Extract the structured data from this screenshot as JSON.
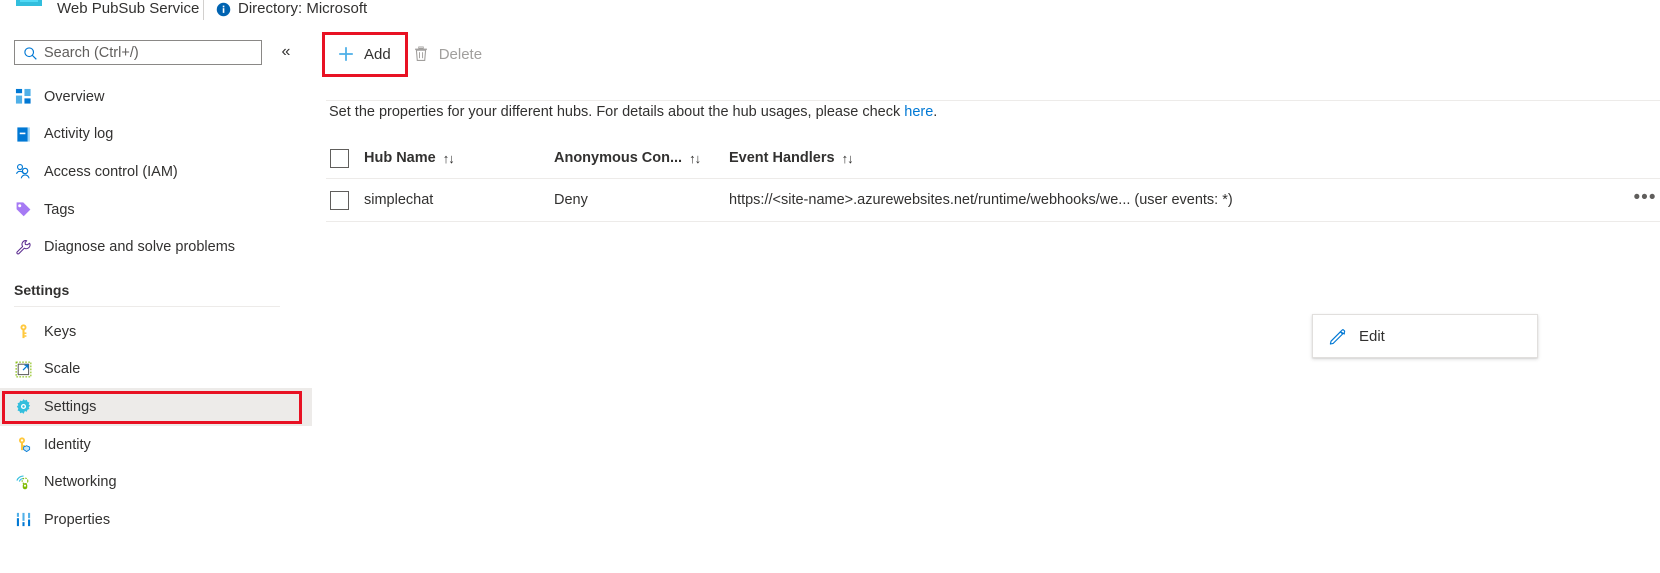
{
  "topbar": {
    "logo_icon": "web-pubsub-logo-icon",
    "service_title": "Web PubSub Service",
    "info_icon": "info-icon",
    "directory_text": "Directory: Microsoft"
  },
  "sidebar": {
    "search": {
      "placeholder": "Search (Ctrl+/)",
      "value": "",
      "icon": "search-icon"
    },
    "collapse_icon": "«",
    "items": [
      {
        "label": "Overview",
        "icon": "overview-icon",
        "selected": false
      },
      {
        "label": "Activity log",
        "icon": "activity-log-icon",
        "selected": false
      },
      {
        "label": "Access control (IAM)",
        "icon": "access-control-icon",
        "selected": false
      },
      {
        "label": "Tags",
        "icon": "tags-icon",
        "selected": false
      },
      {
        "label": "Diagnose and solve problems",
        "icon": "diagnose-icon",
        "selected": false
      }
    ],
    "section_header": "Settings",
    "settings_items": [
      {
        "label": "Keys",
        "icon": "key-icon",
        "selected": false
      },
      {
        "label": "Scale",
        "icon": "scale-icon",
        "selected": false
      },
      {
        "label": "Settings",
        "icon": "gear-icon",
        "selected": true
      },
      {
        "label": "Identity",
        "icon": "identity-icon",
        "selected": false
      },
      {
        "label": "Networking",
        "icon": "networking-icon",
        "selected": false
      },
      {
        "label": "Properties",
        "icon": "properties-icon",
        "selected": false
      }
    ]
  },
  "toolbar": {
    "add_label": "Add",
    "add_icon": "plus-icon",
    "delete_label": "Delete",
    "delete_icon": "trash-icon",
    "delete_disabled": true
  },
  "main": {
    "description_prefix": "Set the properties for your different hubs. For details about the hub usages, please check ",
    "description_link": "here",
    "description_suffix": ".",
    "table": {
      "columns": [
        {
          "label": "Hub Name",
          "sort_icon": "↑↓"
        },
        {
          "label": "Anonymous Con...",
          "sort_icon": "↑↓"
        },
        {
          "label": "Event Handlers",
          "sort_icon": "↑↓"
        }
      ],
      "rows": [
        {
          "hub_name": "simplechat",
          "anonymous_connect": "Deny",
          "event_handlers": "https://<site-name>.azurewebsites.net/runtime/webhooks/we... (user events: *)",
          "ellipsis_icon": "more-options-icon"
        }
      ]
    },
    "context_menu": {
      "edit_label": "Edit",
      "edit_icon": "pencil-icon"
    }
  },
  "annotations": {
    "highlight_color": "#e81123",
    "add_button_highlight": true,
    "settings_nav_highlight": true
  },
  "colors": {
    "accent": "#0078d4",
    "text": "#323130",
    "muted": "#605e5c",
    "disabled": "#a19f9d",
    "selected_bg": "#edebe9",
    "border": "#8a8886",
    "red": "#e81123"
  }
}
